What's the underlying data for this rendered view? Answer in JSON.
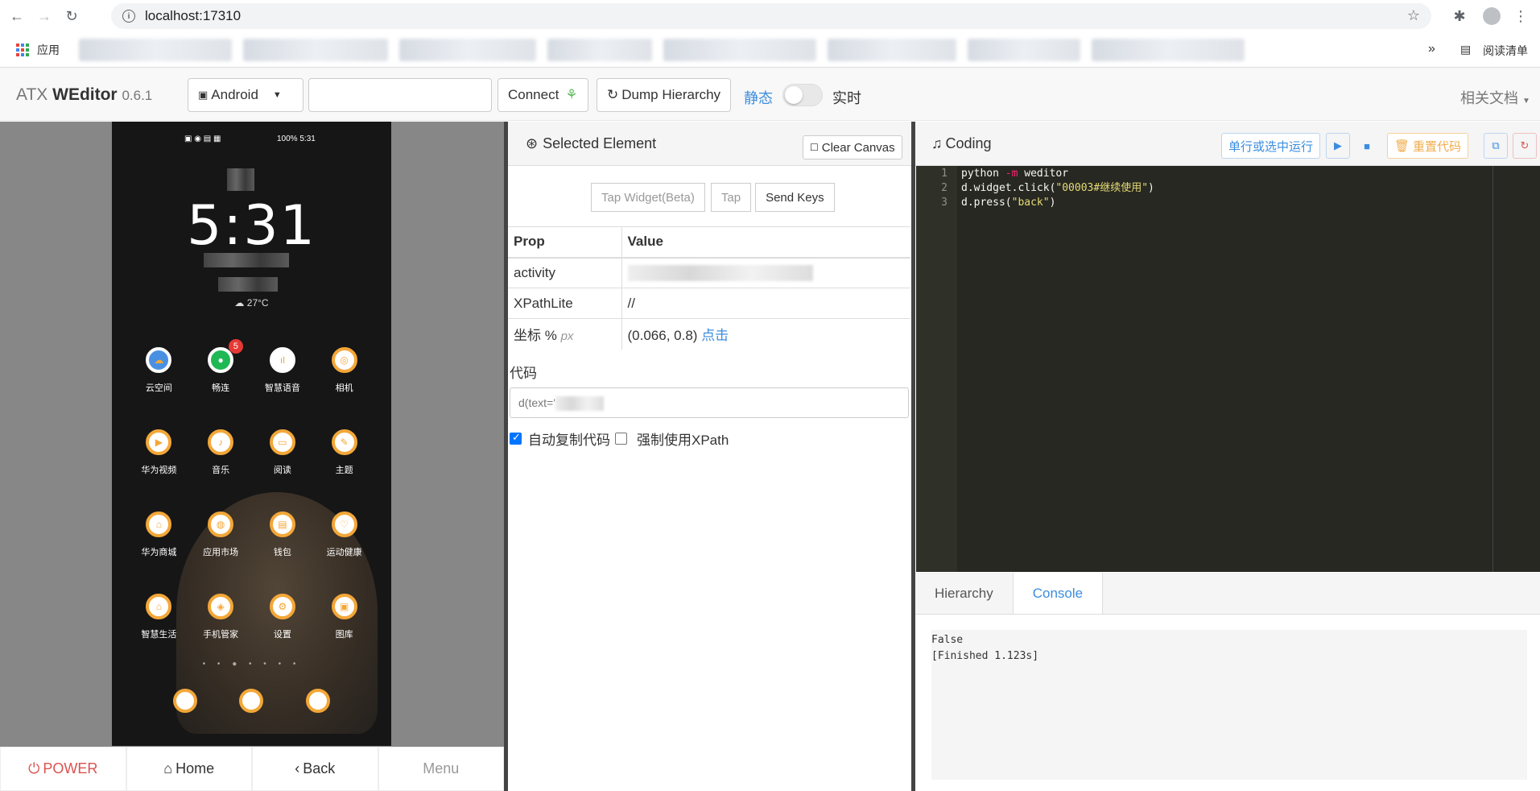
{
  "browser": {
    "url": "localhost:17310",
    "apps_label": "应用",
    "reading_list": "阅读清单",
    "more": "»"
  },
  "header": {
    "brand_prefix": "ATX ",
    "brand_name": "WEditor",
    "version": "0.6.1",
    "platform": "Android",
    "connect": "Connect",
    "dump": "Dump Hierarchy",
    "mode_static": "静态",
    "mode_realtime": "实时",
    "docs": "相关文档"
  },
  "phone": {
    "status": "100%  5:31",
    "clock": "5:31",
    "weather": "27°C",
    "rows": [
      [
        {
          "label": "云空间"
        },
        {
          "label": "畅连",
          "badge": "5"
        },
        {
          "label": "智慧语音"
        },
        {
          "label": "相机"
        }
      ],
      [
        {
          "label": "华为视频"
        },
        {
          "label": "音乐"
        },
        {
          "label": "阅读"
        },
        {
          "label": "主题"
        }
      ],
      [
        {
          "label": "华为商城"
        },
        {
          "label": "应用市场"
        },
        {
          "label": "钱包"
        },
        {
          "label": "运动健康"
        }
      ],
      [
        {
          "label": "智慧生活"
        },
        {
          "label": "手机管家"
        },
        {
          "label": "设置"
        },
        {
          "label": "图库"
        }
      ]
    ]
  },
  "bottom_bar": {
    "power": "POWER",
    "home": "Home",
    "back": "Back",
    "menu": "Menu"
  },
  "selected": {
    "title": "Selected Element",
    "clear": "Clear Canvas",
    "tap_widget": "Tap Widget(Beta)",
    "tap": "Tap",
    "send_keys": "Send Keys",
    "prop_header": "Prop",
    "value_header": "Value",
    "rows": {
      "activity": "activity",
      "xpath_label": "XPathLite",
      "xpath_value": "//",
      "coord_label": "坐标 %",
      "coord_unit": "px",
      "coord_value": "(0.066, 0.8)",
      "coord_click": "点击"
    },
    "code_label": "代码",
    "code_value": "d(text='",
    "auto_copy": "自动复制代码",
    "force_xpath": "强制使用XPath"
  },
  "coding": {
    "title": "Coding",
    "run_selection": "单行或选中运行",
    "reset_code": "重置代码",
    "line_numbers": [
      "1",
      "2",
      "3"
    ],
    "lines": [
      {
        "pre": "python ",
        "kw": "-m",
        "post": " weditor",
        "str": "",
        "end": ""
      },
      {
        "pre": "d.widget.click(",
        "kw": "",
        "post": "",
        "str": "\"00003#继续使用\"",
        "end": ")"
      },
      {
        "pre": "d.press(",
        "kw": "",
        "post": "",
        "str": "\"back\"",
        "end": ")"
      }
    ],
    "tab_hierarchy": "Hierarchy",
    "tab_console": "Console",
    "console_lines": [
      "False",
      "[Finished 1.123s]"
    ]
  }
}
